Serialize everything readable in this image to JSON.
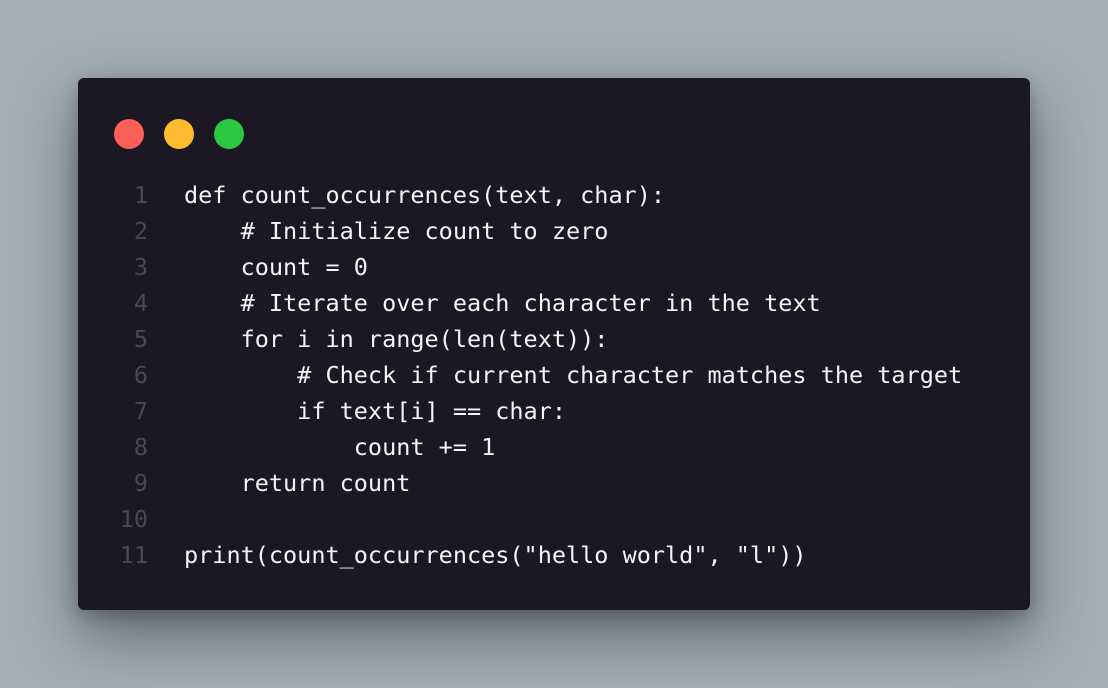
{
  "window": {
    "traffic_lights": [
      {
        "name": "close",
        "color": "#fe5f58"
      },
      {
        "name": "minimize",
        "color": "#febc2e"
      },
      {
        "name": "maximize",
        "color": "#28c840"
      }
    ]
  },
  "editor": {
    "lines": [
      {
        "number": "1",
        "code": "def count_occurrences(text, char):"
      },
      {
        "number": "2",
        "code": "    # Initialize count to zero"
      },
      {
        "number": "3",
        "code": "    count = 0"
      },
      {
        "number": "4",
        "code": "    # Iterate over each character in the text"
      },
      {
        "number": "5",
        "code": "    for i in range(len(text)):"
      },
      {
        "number": "6",
        "code": "        # Check if current character matches the target"
      },
      {
        "number": "7",
        "code": "        if text[i] == char:"
      },
      {
        "number": "8",
        "code": "            count += 1"
      },
      {
        "number": "9",
        "code": "    return count"
      },
      {
        "number": "10",
        "code": ""
      },
      {
        "number": "11",
        "code": "print(count_occurrences(\"hello world\", \"l\"))"
      }
    ]
  }
}
